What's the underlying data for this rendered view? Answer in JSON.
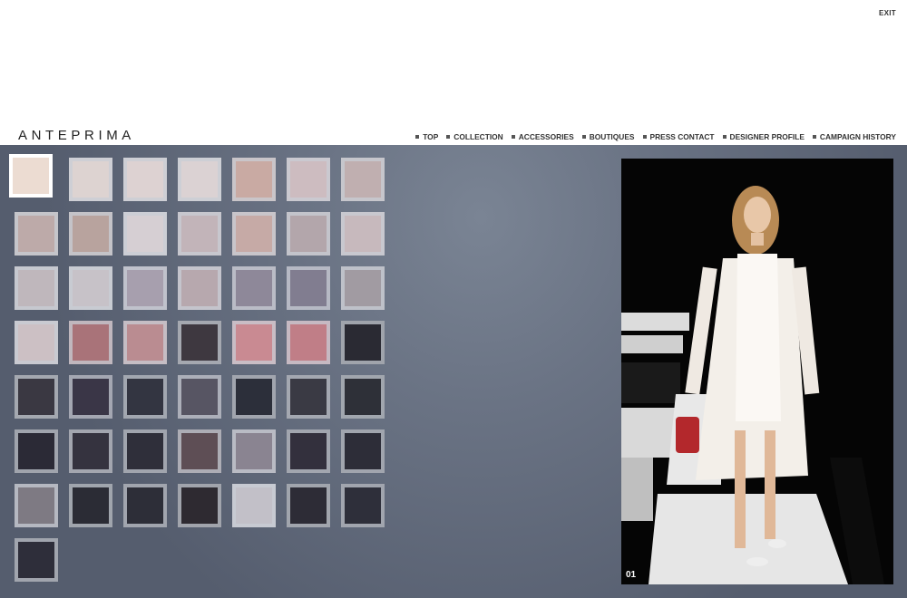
{
  "header": {
    "exit_label": "EXIT",
    "logo": "ANTEPRIMA"
  },
  "nav": [
    {
      "label": "TOP"
    },
    {
      "label": "COLLECTION"
    },
    {
      "label": "ACCESSORIES"
    },
    {
      "label": "BOUTIQUES"
    },
    {
      "label": "PRESS CONTACT"
    },
    {
      "label": "DESIGNER PROFILE"
    },
    {
      "label": "CAMPAIGN HISTORY"
    }
  ],
  "thumbnails": [
    "#ecdcd2",
    "#ddd3d1",
    "#ddd2d2",
    "#dbd2d3",
    "#c9aaa3",
    "#cdbcc0",
    "#c0afb0",
    "#bdaaa9",
    "#b8a39e",
    "#d6cfd3",
    "#c2b4b9",
    "#c6aaa6",
    "#b3a6ab",
    "#c7b9bd",
    "#bfb7bc",
    "#c7c2c8",
    "#a79fae",
    "#b7a8ae",
    "#8e8899",
    "#817d90",
    "#a19ba2",
    "#ccc0c4",
    "#a97379",
    "#ba8c91",
    "#3e3840",
    "#c98a92",
    "#c07e87",
    "#2a2a33",
    "#3a3842",
    "#3a3647",
    "#333541",
    "#575563",
    "#2c2f3a",
    "#3a3a44",
    "#2e3038",
    "#2b2a36",
    "#35333f",
    "#2f2f3a",
    "#5e4e55",
    "#8a8491",
    "#33303d",
    "#2d2d38",
    "#7e7a83",
    "#2b2c35",
    "#2d2e38",
    "#2e2a31",
    "#c2c0c8",
    "#2d2c36",
    "#2e2f3a",
    "#2e2e3a"
  ],
  "active_index": 0,
  "photo": {
    "number": "01"
  },
  "colors": {
    "stage_bg": "#6a7384",
    "thumb_border": "#c8cdd6"
  }
}
